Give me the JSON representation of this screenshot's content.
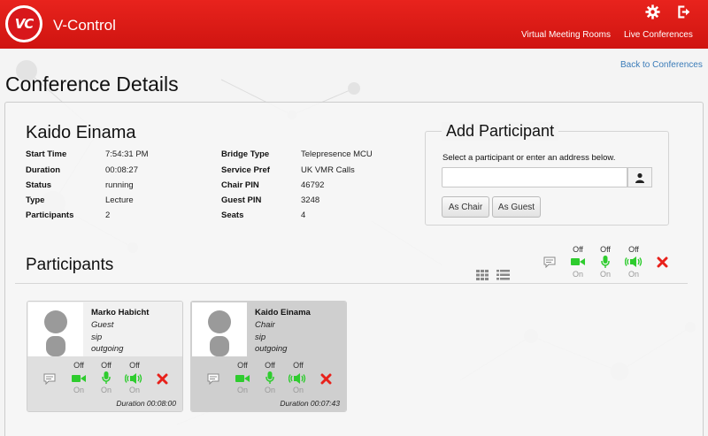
{
  "header": {
    "logo_text": "VC",
    "app_title": "V-Control",
    "nav": [
      "Virtual Meeting Rooms",
      "Live Conferences"
    ],
    "icons": [
      "settings-icon",
      "logout-icon"
    ],
    "color": "#dd1a16"
  },
  "back_link": "Back to Conferences",
  "page_title": "Conference Details",
  "conference": {
    "name": "Kaido Einama",
    "left_details": [
      {
        "label": "Start Time",
        "value": "7:54:31 PM"
      },
      {
        "label": "Duration",
        "value": "00:08:27"
      },
      {
        "label": "Status",
        "value": "running"
      },
      {
        "label": "Type",
        "value": "Lecture"
      },
      {
        "label": "Participants",
        "value": "2"
      }
    ],
    "right_details": [
      {
        "label": "Bridge Type",
        "value": "Telepresence MCU"
      },
      {
        "label": "Service Pref",
        "value": "UK VMR Calls"
      },
      {
        "label": "Chair PIN",
        "value": "46792"
      },
      {
        "label": "Guest PIN",
        "value": "3248"
      },
      {
        "label": "Seats",
        "value": "4"
      }
    ]
  },
  "add_participant": {
    "title": "Add Participant",
    "hint": "Select a participant or enter an address below.",
    "input_value": "",
    "input_placeholder": "",
    "as_chair": "As Chair",
    "as_guest": "As Guest"
  },
  "participants_section": {
    "title": "Participants",
    "global_controls": {
      "video_top": "Off",
      "video_bottom": "On",
      "audio_top": "Off",
      "audio_bottom": "On",
      "speaker_top": "Off",
      "speaker_bottom": "On"
    }
  },
  "participants": [
    {
      "name": "Marko Habicht",
      "role": "Guest",
      "protocol": "sip",
      "direction": "outgoing",
      "duration": "Duration 00:08:00",
      "controls": {
        "video_top": "Off",
        "video_bottom": "On",
        "audio_top": "Off",
        "audio_bottom": "On",
        "speaker_top": "Off",
        "speaker_bottom": "On"
      }
    },
    {
      "name": "Kaido Einama",
      "role": "Chair",
      "protocol": "sip",
      "direction": "outgoing",
      "duration": "Duration 00:07:43",
      "controls": {
        "video_top": "Off",
        "video_bottom": "On",
        "audio_top": "Off",
        "audio_bottom": "On",
        "speaker_top": "Off",
        "speaker_bottom": "On"
      }
    }
  ],
  "colors": {
    "accent_green": "#2ecc2e",
    "remove_red": "#e8211b",
    "link_blue": "#3a7bb8"
  }
}
